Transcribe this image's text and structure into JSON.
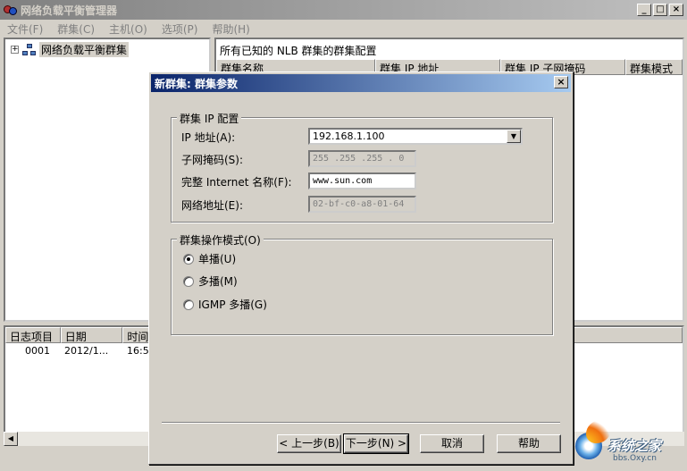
{
  "app": {
    "title": "网络负载平衡管理器",
    "window_buttons": {
      "minimize": "_",
      "maximize": "□",
      "close": "×"
    }
  },
  "menu": [
    "文件(F)",
    "群集(C)",
    "主机(O)",
    "选项(P)",
    "帮助(H)"
  ],
  "tree": {
    "expander": "+",
    "root_label": "网络负载平衡群集"
  },
  "cluster_list": {
    "header": "所有已知的 NLB 群集的群集配置",
    "columns": [
      "群集名称",
      "群集 IP 地址",
      "群集 IP 子网掩码",
      "群集模式"
    ]
  },
  "log": {
    "columns": [
      "日志项目",
      "日期",
      "时间"
    ],
    "rows": [
      [
        "0001",
        "2012/1...",
        "16:5"
      ]
    ]
  },
  "watermark": {
    "text": "系统之家",
    "site": "bbs.Oxy.cn"
  },
  "dialog": {
    "title": "新群集:  群集参数",
    "close": "×",
    "ip_group": {
      "legend": "群集 IP 配置",
      "ip_label": "IP 地址(A):",
      "ip_value": "192.168.1.100",
      "subnet_label": "子网掩码(S):",
      "subnet_value": "255 .255 .255 . 0",
      "fqdn_label": "完整 Internet 名称(F):",
      "fqdn_value": "www.sun.com",
      "netaddr_label": "网络地址(E):",
      "netaddr_value": "02-bf-c0-a8-01-64"
    },
    "mode_group": {
      "legend": "群集操作模式(O)",
      "options": [
        {
          "label": "单播(U)",
          "checked": true
        },
        {
          "label": "多播(M)",
          "checked": false
        },
        {
          "label": "IGMP 多播(G)",
          "checked": false
        }
      ]
    },
    "buttons": {
      "back": "< 上一步(B)",
      "next": "下一步(N) >",
      "cancel": "取消",
      "help": "帮助"
    }
  }
}
